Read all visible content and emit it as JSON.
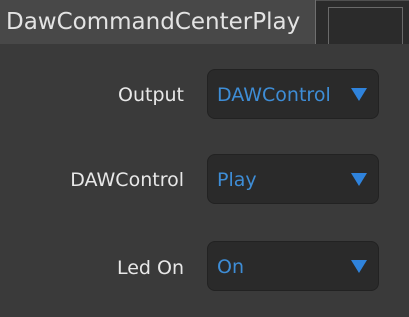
{
  "tab": {
    "title": "DawCommandCenterPlay"
  },
  "rows": [
    {
      "label": "Output",
      "value": "DAWControl"
    },
    {
      "label": "DAWControl",
      "value": "Play"
    },
    {
      "label": "Led On",
      "value": "On"
    }
  ],
  "colors": {
    "background": "#3a3a3a",
    "dropdown_bg": "#2a2a2a",
    "value_text": "#3e8dd6",
    "caret": "#2f83dc",
    "label_text": "#e8e8e8"
  }
}
